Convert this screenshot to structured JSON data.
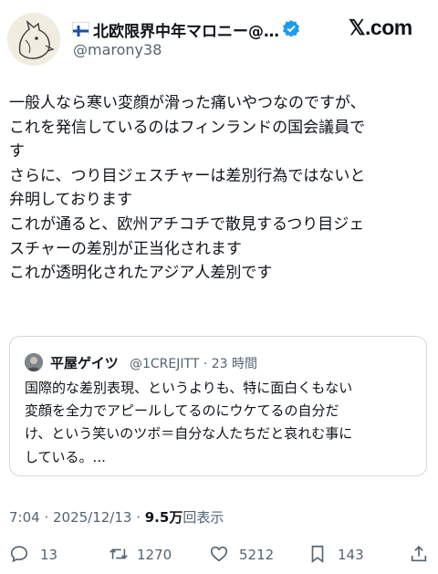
{
  "author": {
    "display_name": "北欧限界中年マロニー@…",
    "handle": "@marony38",
    "flag_icon": "finland-flag-icon",
    "verified_icon": "verified-badge-icon",
    "verified_color": "#1d9bf0"
  },
  "site": {
    "label": "𝕏.com"
  },
  "tweet": {
    "lines": [
      "一般人なら寒い変顔が滑った痛いやつなのですが、",
      "これを発信しているのはフィンランドの国会議員で",
      "す",
      "さらに、つり目ジェスチャーは差別行為ではないと",
      "弁明しております",
      "これが通ると、欧州アチコチで散見するつり目ジェ",
      "スチャーの差別が正当化されます",
      "これが透明化されたアジア人差別です"
    ]
  },
  "quote": {
    "name": "平屋ゲイツ",
    "meta": "@1CREJITT · 23 時間",
    "lines": [
      "国際的な差別表現、というよりも、特に面白くもない",
      "変顔を全力でアピールしてるのにウケてるの自分だ",
      "け、という笑いのツボ＝自分な人たちだと哀れむ事に",
      "している。..."
    ]
  },
  "meta": {
    "timestamp": "7:04 · 2025/12/13 · ",
    "views_value": "9.5万",
    "views_label": "回表示"
  },
  "actions": {
    "replies": "13",
    "reposts": "1270",
    "likes": "5212",
    "bookmarks": "143"
  },
  "colors": {
    "text": "#0f1419",
    "secondary": "#536471",
    "border": "#cfd9de"
  }
}
